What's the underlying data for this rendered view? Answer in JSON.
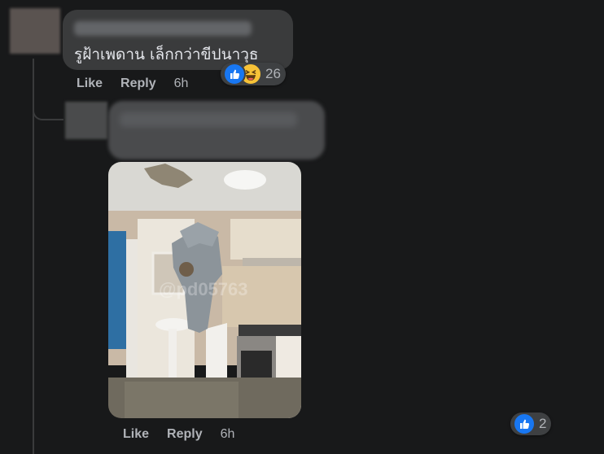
{
  "comments": [
    {
      "text": "รูฝ้าเพดาน เล็กกว่าขีปนาวุธ",
      "actions": {
        "like": "Like",
        "reply": "Reply",
        "time": "6h"
      },
      "reactions": {
        "icons": [
          "like-icon",
          "haha-icon"
        ],
        "count": "26"
      }
    },
    {
      "actions": {
        "like": "Like",
        "reply": "Reply",
        "time": "6h"
      },
      "reactions": {
        "icons": [
          "like-icon"
        ],
        "count": "2"
      },
      "photo": {
        "watermark": "@pd05763"
      }
    }
  ],
  "colors": {
    "background": "#18191a",
    "bubble": "#3a3b3c",
    "action_text": "#b0b3b8",
    "like_blue": "#1877f2",
    "haha_yellow": "#f7c237"
  }
}
